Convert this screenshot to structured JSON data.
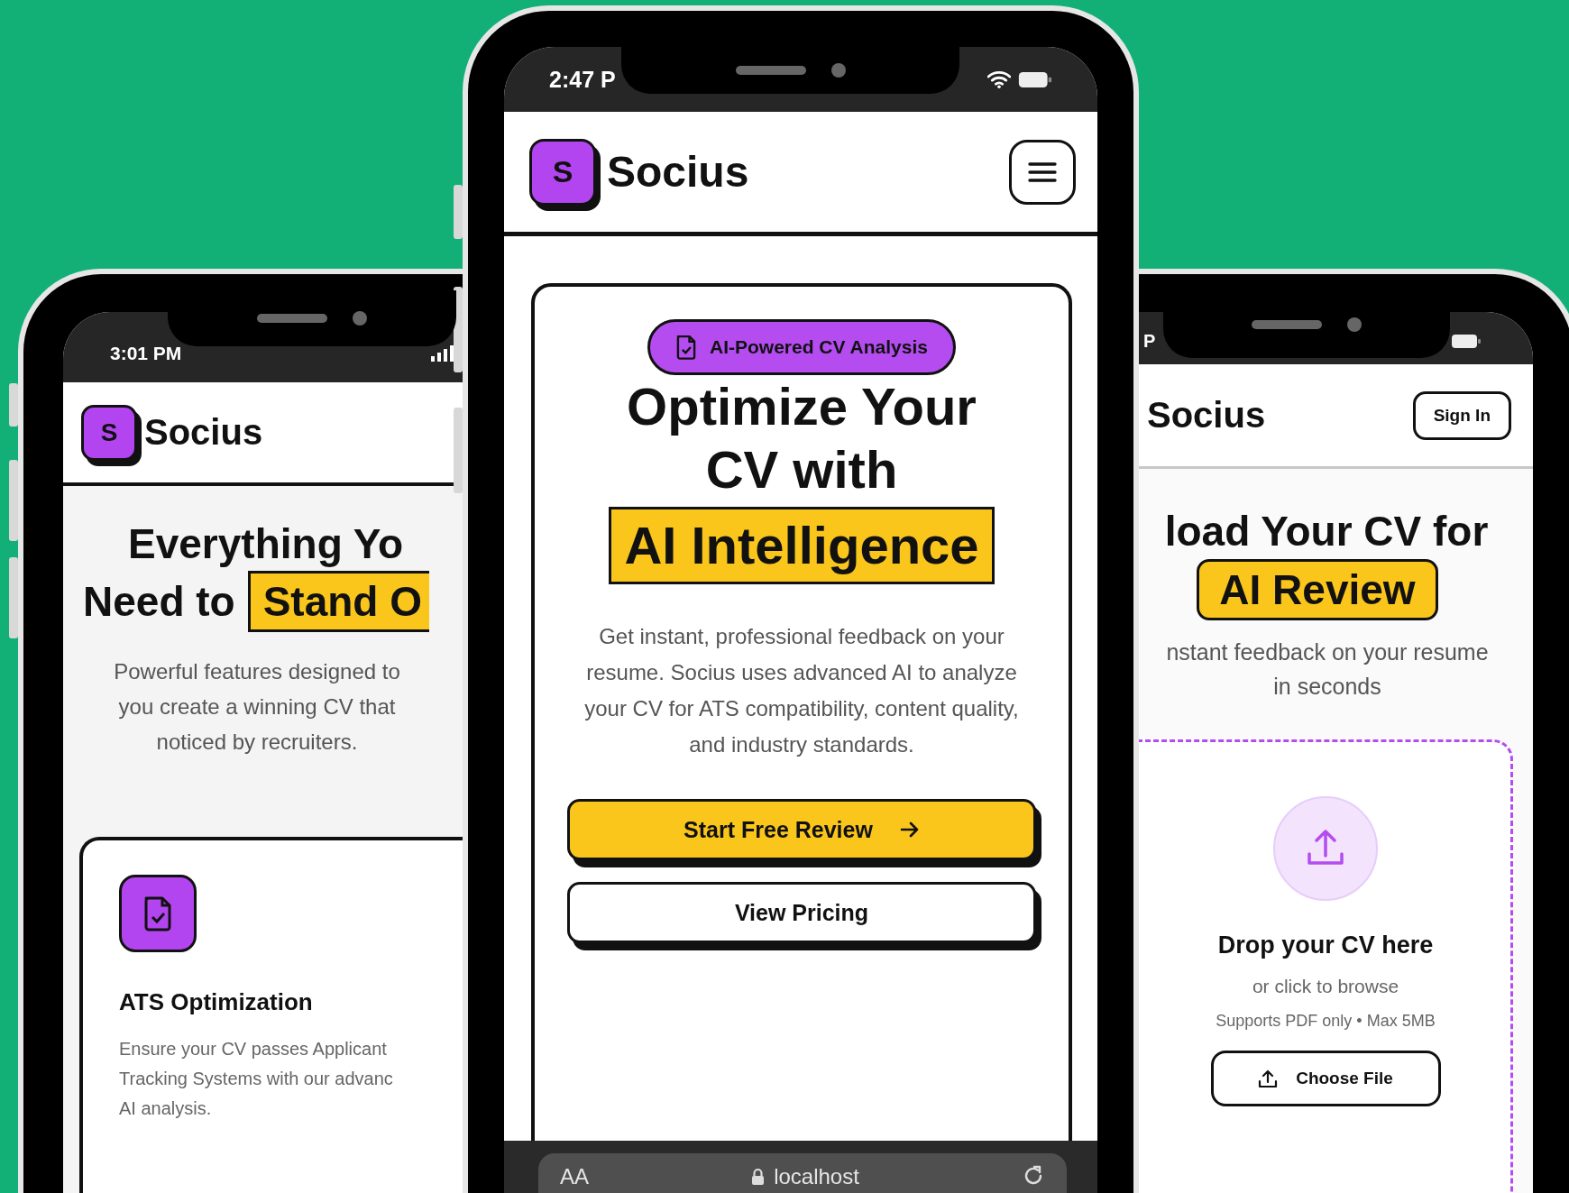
{
  "phone_left": {
    "status_bar": {
      "time": "3:01 PM"
    },
    "header": {
      "logo_letter": "S",
      "brand": "Socius"
    },
    "heading": {
      "line_1": "Everything Yo",
      "line_2": "Need to",
      "highlight": "Stand O"
    },
    "subtitle": [
      "Powerful features designed to",
      "you create a winning CV that",
      "noticed by recruiters."
    ],
    "feature_card": {
      "title": "ATS Optimization",
      "description": [
        "Ensure your CV passes Applicant",
        "Tracking Systems with our advanc",
        "AI analysis."
      ]
    }
  },
  "phone_center": {
    "status_bar": {
      "time": "2:47 P"
    },
    "header": {
      "logo_letter": "S",
      "brand": "Socius"
    },
    "badge": "AI-Powered CV Analysis",
    "heading": {
      "line_1": "Optimize Your",
      "line_2": "CV with",
      "highlight": "AI Intelligence"
    },
    "paragraph": "Get instant, professional feedback on your resume. Socius uses advanced AI to analyze your CV for ATS compatibility, content quality, and industry standards.",
    "buttons": [
      {
        "label": "Start Free Review",
        "kind": "primary"
      },
      {
        "label": "View Pricing",
        "kind": "secondary"
      }
    ],
    "browser_bar": {
      "text_size": "AA",
      "address": "localhost"
    }
  },
  "phone_right": {
    "status_bar": {
      "time": "P"
    },
    "header": {
      "brand": "Socius",
      "sign_in": "Sign In"
    },
    "heading": {
      "line_1": "load Your CV for",
      "highlight": "AI Review"
    },
    "subtitle": [
      "nstant feedback on your resume",
      "in seconds"
    ],
    "upload": {
      "title": "Drop your CV here",
      "hint": "or click to browse",
      "limits": "Supports PDF only • Max 5MB",
      "button": "Choose File"
    }
  }
}
